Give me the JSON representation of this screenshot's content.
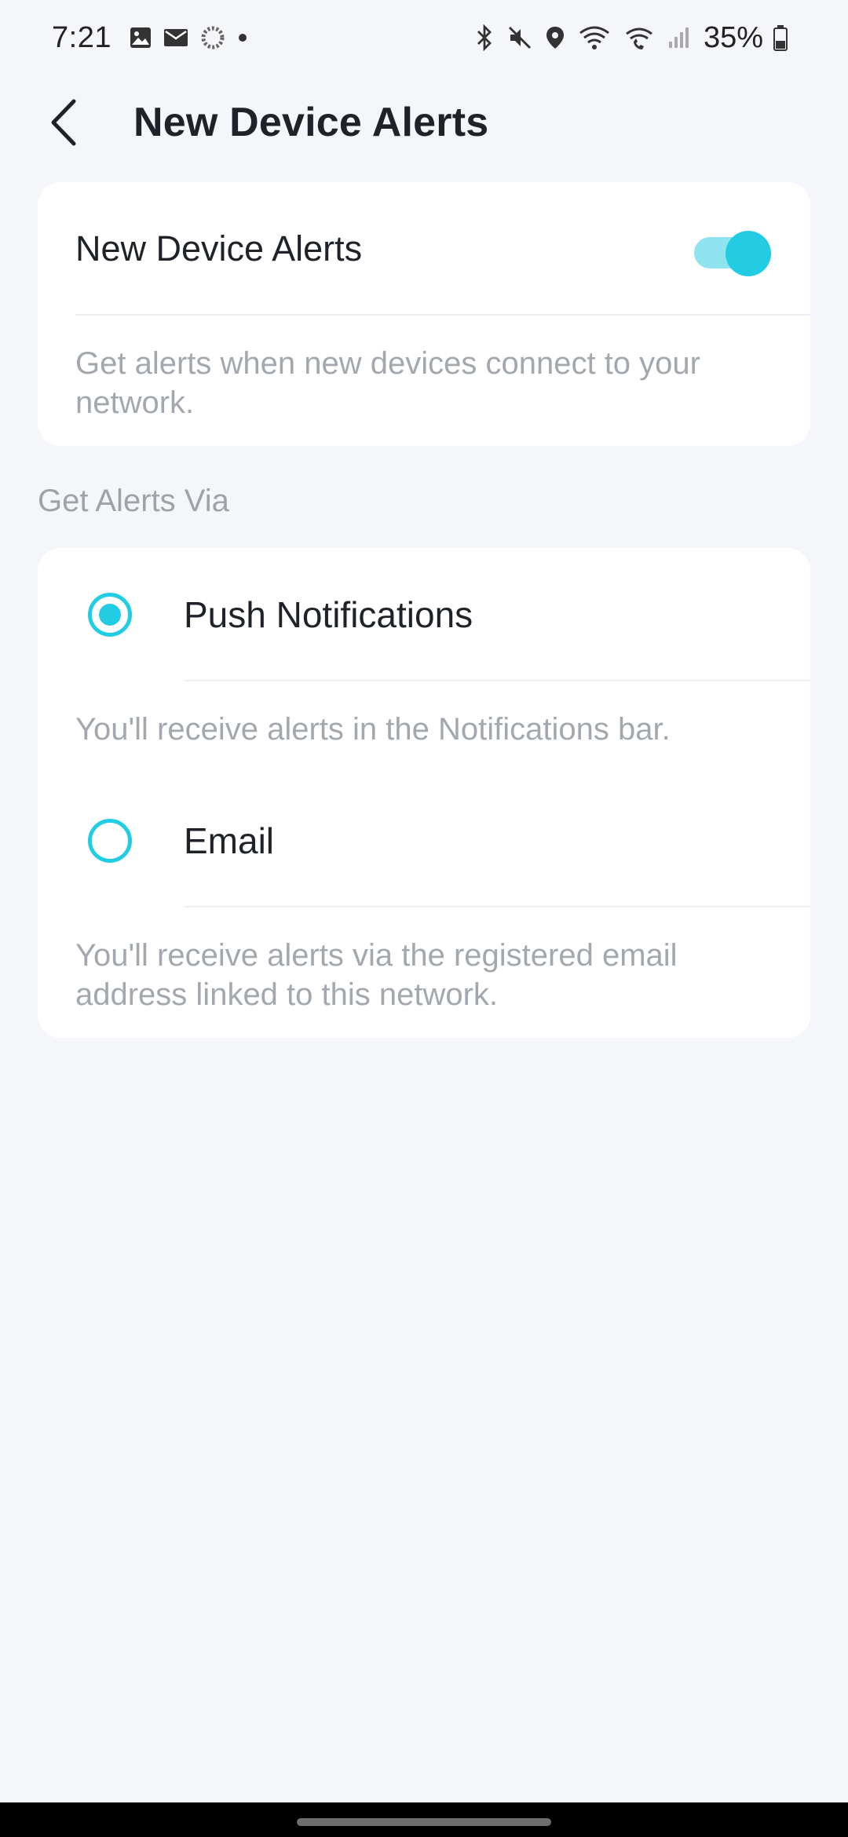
{
  "status_bar": {
    "time": "7:21",
    "battery_percent": "35%",
    "left_icons": [
      "gallery-icon",
      "mail-icon",
      "sync-icon",
      "dot-icon"
    ],
    "right_icons": [
      "bluetooth-icon",
      "mute-icon",
      "location-icon",
      "wifi-icon",
      "wifi-calling-icon",
      "signal-icon",
      "battery-icon"
    ]
  },
  "header": {
    "title": "New Device Alerts",
    "back_icon": "chevron-left-icon"
  },
  "toggle_card": {
    "label": "New Device Alerts",
    "enabled": true,
    "description": "Get alerts when new devices connect to your network."
  },
  "alerts_section": {
    "label": "Get Alerts Via",
    "options": [
      {
        "label": "Push Notifications",
        "selected": true,
        "description": "You'll receive alerts in the Notifications bar."
      },
      {
        "label": "Email",
        "selected": false,
        "description": "You'll receive alerts via the registered email address linked to this network."
      }
    ]
  },
  "colors": {
    "accent": "#22cde3",
    "accent_light": "#8fe4ef",
    "background": "#f4f6fa",
    "card": "#ffffff",
    "secondary_text": "#a3a8ae"
  }
}
